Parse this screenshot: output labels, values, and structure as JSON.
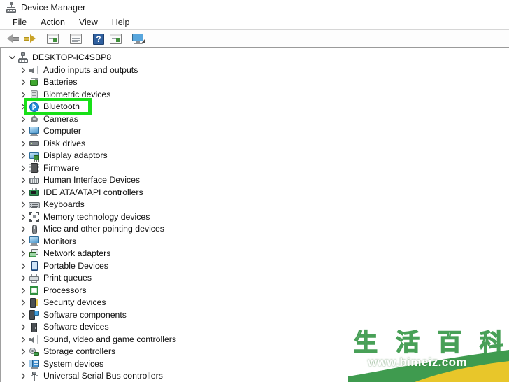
{
  "window": {
    "title": "Device Manager",
    "icon": "device-manager-icon"
  },
  "menu": {
    "items": [
      {
        "label": "File"
      },
      {
        "label": "Action"
      },
      {
        "label": "View"
      },
      {
        "label": "Help"
      }
    ]
  },
  "toolbar": {
    "buttons": [
      {
        "name": "back-button",
        "icon": "back-arrow-icon",
        "title": "Back"
      },
      {
        "name": "forward-button",
        "icon": "forward-arrow-icon",
        "title": "Forward"
      },
      {
        "name": "properties-button",
        "icon": "properties-icon",
        "title": "Properties"
      },
      {
        "name": "update-driver-button",
        "icon": "update-driver-icon",
        "title": "Update driver"
      },
      {
        "name": "help-button",
        "icon": "help-icon",
        "title": "Help"
      },
      {
        "name": "enable-device-button",
        "icon": "enable-device-icon",
        "title": "Enable device"
      },
      {
        "name": "scan-hardware-button",
        "icon": "scan-hardware-icon",
        "title": "Scan for hardware changes"
      }
    ],
    "help_glyph": "?"
  },
  "tree": {
    "root": {
      "label": "DESKTOP-IC4SBP8",
      "icon": "computer-root-icon",
      "expanded": true
    },
    "items": [
      {
        "label": "Audio inputs and outputs",
        "icon": "speaker-icon",
        "iconClass": "i-speaker"
      },
      {
        "label": "Batteries",
        "icon": "battery-icon",
        "iconClass": "i-battery"
      },
      {
        "label": "Biometric devices",
        "icon": "biometric-icon",
        "iconClass": "i-biometric"
      },
      {
        "label": "Bluetooth",
        "icon": "bluetooth-icon",
        "iconClass": "i-bt",
        "highlighted": true
      },
      {
        "label": "Cameras",
        "icon": "camera-icon",
        "iconClass": "i-camera"
      },
      {
        "label": "Computer",
        "icon": "monitor-icon",
        "iconClass": "i-monitor"
      },
      {
        "label": "Disk drives",
        "icon": "disk-drive-icon",
        "iconClass": "i-disk"
      },
      {
        "label": "Display adaptors",
        "icon": "display-adapter-icon",
        "iconClass": "i-display"
      },
      {
        "label": "Firmware",
        "icon": "firmware-chip-icon",
        "iconClass": "i-firmware"
      },
      {
        "label": "Human Interface Devices",
        "icon": "hid-icon",
        "iconClass": "i-hid"
      },
      {
        "label": "IDE ATA/ATAPI controllers",
        "icon": "ide-controller-icon",
        "iconClass": "i-ide"
      },
      {
        "label": "Keyboards",
        "icon": "keyboard-icon",
        "iconClass": "i-keyboard"
      },
      {
        "label": "Memory technology devices",
        "icon": "memory-icon",
        "iconClass": "i-memory"
      },
      {
        "label": "Mice and other pointing devices",
        "icon": "mouse-icon",
        "iconClass": "i-mouse"
      },
      {
        "label": "Monitors",
        "icon": "monitor-icon",
        "iconClass": "i-monitor"
      },
      {
        "label": "Network adapters",
        "icon": "network-adapter-icon",
        "iconClass": "i-network"
      },
      {
        "label": "Portable Devices",
        "icon": "portable-device-icon",
        "iconClass": "i-portable"
      },
      {
        "label": "Print queues",
        "icon": "printer-icon",
        "iconClass": "i-print"
      },
      {
        "label": "Processors",
        "icon": "processor-icon",
        "iconClass": "i-proc"
      },
      {
        "label": "Security devices",
        "icon": "security-device-icon",
        "iconClass": "i-security"
      },
      {
        "label": "Software components",
        "icon": "software-component-icon",
        "iconClass": "i-swcomp"
      },
      {
        "label": "Software devices",
        "icon": "software-device-icon",
        "iconClass": "i-swdev"
      },
      {
        "label": "Sound, video and game controllers",
        "icon": "speaker-icon",
        "iconClass": "i-speaker"
      },
      {
        "label": "Storage controllers",
        "icon": "storage-controller-icon",
        "iconClass": "i-storage"
      },
      {
        "label": "System devices",
        "icon": "system-device-icon",
        "iconClass": "i-system"
      },
      {
        "label": "Universal Serial Bus controllers",
        "icon": "usb-icon",
        "iconClass": "i-usb"
      }
    ]
  },
  "annotation": {
    "target": "Bluetooth",
    "color": "#18e018",
    "shape": "rectangle"
  },
  "watermark": {
    "cjk_chars": [
      "生",
      "活",
      "百",
      "科"
    ],
    "url": "www.bimeiz.com",
    "green": "#3f9b4f",
    "yellow": "#e8c62a"
  }
}
